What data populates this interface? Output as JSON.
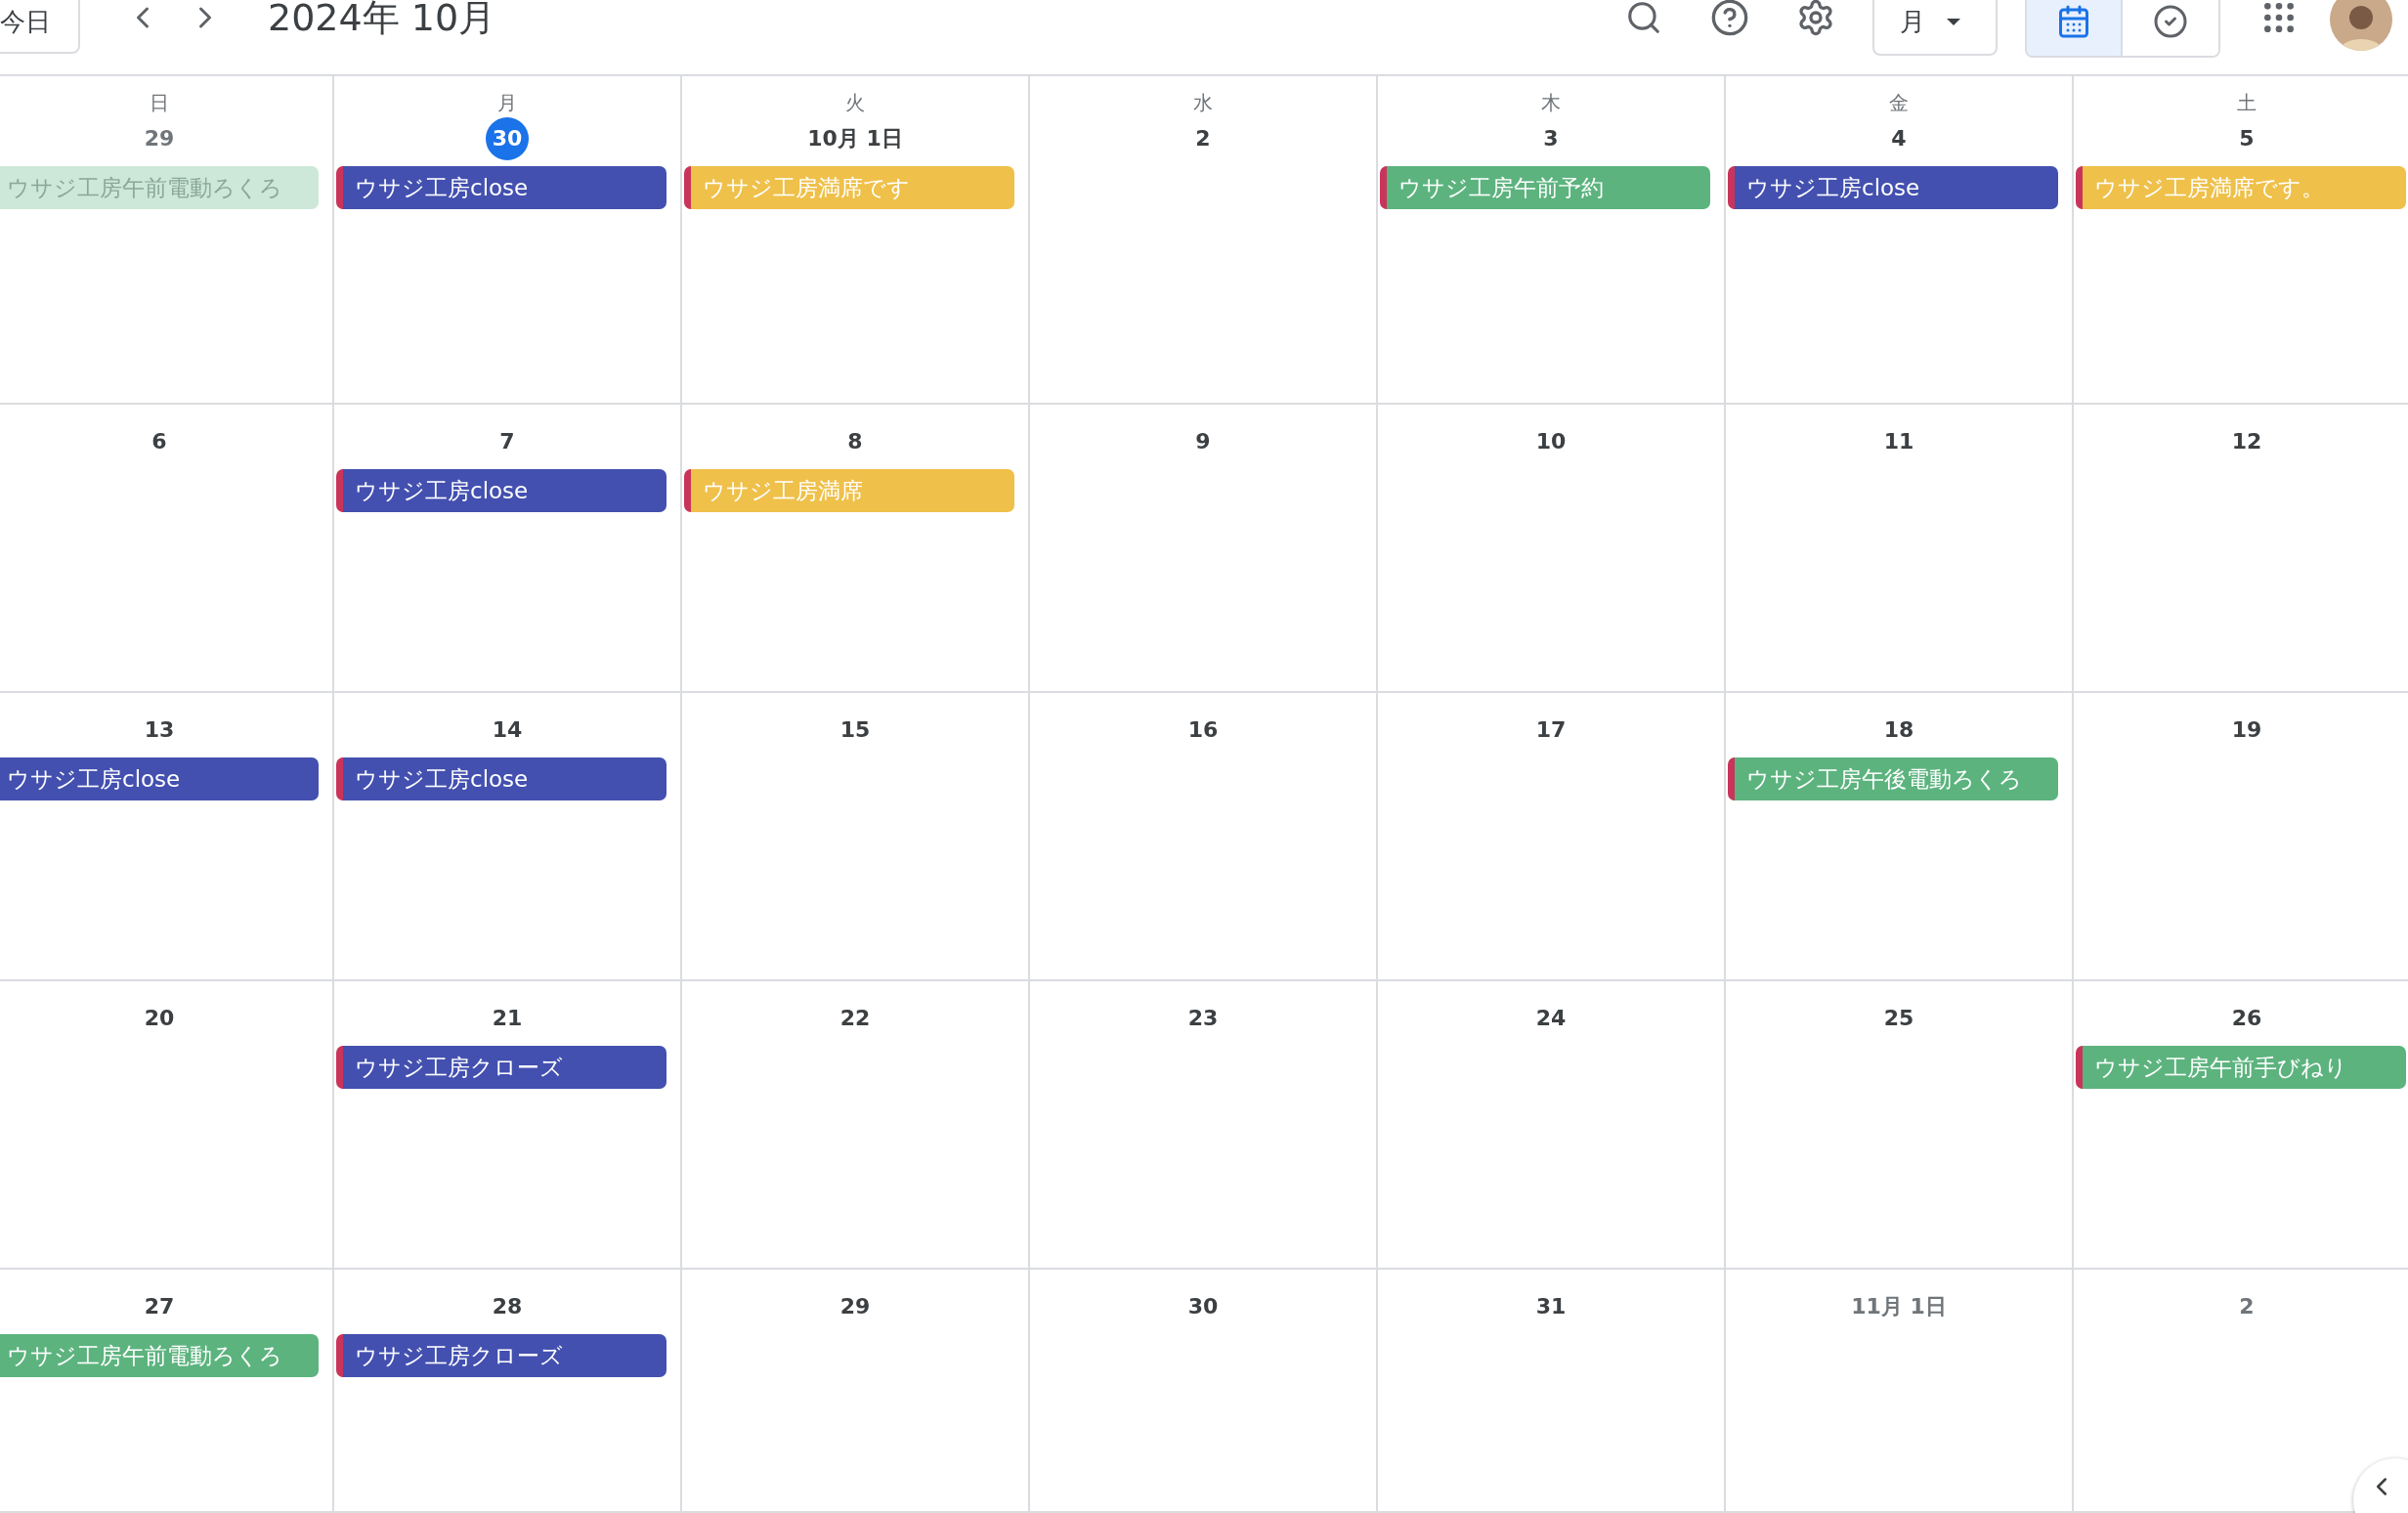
{
  "toolbar": {
    "today_button": "今日",
    "title": "2024年 10月",
    "view_select": "月",
    "view_toggle": [
      {
        "kind": "calendar",
        "selected": true
      },
      {
        "kind": "tasks",
        "selected": false
      }
    ]
  },
  "weekdays": [
    "日",
    "月",
    "火",
    "水",
    "木",
    "金",
    "土"
  ],
  "weeks": [
    [
      {
        "label": "29",
        "in_month": false,
        "today": false,
        "events": [
          {
            "title": "ウサジ工房午前電動ろくろ",
            "color": "#cde8d8",
            "faded": true
          }
        ]
      },
      {
        "label": "30",
        "in_month": false,
        "today": true,
        "events": [
          {
            "title": "ウサジ工房close",
            "color": "#4350af",
            "faded": false
          }
        ]
      },
      {
        "label": "10月 1日",
        "in_month": true,
        "today": false,
        "events": [
          {
            "title": "ウサジ工房満席です",
            "color": "#efc04a",
            "faded": false
          }
        ]
      },
      {
        "label": "2",
        "in_month": true,
        "today": false
      },
      {
        "label": "3",
        "in_month": true,
        "today": false,
        "events": [
          {
            "title": "ウサジ工房午前予約",
            "color": "#5cb37e",
            "faded": false
          }
        ]
      },
      {
        "label": "4",
        "in_month": true,
        "today": false,
        "events": [
          {
            "title": "ウサジ工房close",
            "color": "#4350af",
            "faded": false
          }
        ]
      },
      {
        "label": "5",
        "in_month": true,
        "today": false,
        "events": [
          {
            "title": "ウサジ工房満席です。",
            "color": "#efc04a",
            "faded": false
          }
        ]
      }
    ],
    [
      {
        "label": "6",
        "in_month": true,
        "today": false
      },
      {
        "label": "7",
        "in_month": true,
        "today": false,
        "events": [
          {
            "title": "ウサジ工房close",
            "color": "#4350af",
            "faded": false
          }
        ]
      },
      {
        "label": "8",
        "in_month": true,
        "today": false,
        "events": [
          {
            "title": "ウサジ工房満席",
            "color": "#efc04a",
            "faded": false
          }
        ]
      },
      {
        "label": "9",
        "in_month": true,
        "today": false
      },
      {
        "label": "10",
        "in_month": true,
        "today": false
      },
      {
        "label": "11",
        "in_month": true,
        "today": false
      },
      {
        "label": "12",
        "in_month": true,
        "today": false
      }
    ],
    [
      {
        "label": "13",
        "in_month": true,
        "today": false,
        "events": [
          {
            "title": "ウサジ工房close",
            "color": "#4350af",
            "faded": false
          }
        ]
      },
      {
        "label": "14",
        "in_month": true,
        "today": false,
        "events": [
          {
            "title": "ウサジ工房close",
            "color": "#4350af",
            "faded": false
          }
        ]
      },
      {
        "label": "15",
        "in_month": true,
        "today": false
      },
      {
        "label": "16",
        "in_month": true,
        "today": false
      },
      {
        "label": "17",
        "in_month": true,
        "today": false
      },
      {
        "label": "18",
        "in_month": true,
        "today": false,
        "events": [
          {
            "title": "ウサジ工房午後電動ろくろ",
            "color": "#5cb37e",
            "faded": false
          }
        ]
      },
      {
        "label": "19",
        "in_month": true,
        "today": false
      }
    ],
    [
      {
        "label": "20",
        "in_month": true,
        "today": false
      },
      {
        "label": "21",
        "in_month": true,
        "today": false,
        "events": [
          {
            "title": "ウサジ工房クローズ",
            "color": "#4350af",
            "faded": false
          }
        ]
      },
      {
        "label": "22",
        "in_month": true,
        "today": false
      },
      {
        "label": "23",
        "in_month": true,
        "today": false
      },
      {
        "label": "24",
        "in_month": true,
        "today": false
      },
      {
        "label": "25",
        "in_month": true,
        "today": false
      },
      {
        "label": "26",
        "in_month": true,
        "today": false,
        "events": [
          {
            "title": "ウサジ工房午前手びねり",
            "color": "#5cb37e",
            "faded": false
          }
        ]
      }
    ],
    [
      {
        "label": "27",
        "in_month": true,
        "today": false,
        "events": [
          {
            "title": "ウサジ工房午前電動ろくろ",
            "color": "#5cb37e",
            "faded": false
          }
        ]
      },
      {
        "label": "28",
        "in_month": true,
        "today": false,
        "events": [
          {
            "title": "ウサジ工房クローズ",
            "color": "#4350af",
            "faded": false
          }
        ]
      },
      {
        "label": "29",
        "in_month": true,
        "today": false
      },
      {
        "label": "30",
        "in_month": true,
        "today": false
      },
      {
        "label": "31",
        "in_month": true,
        "today": false
      },
      {
        "label": "11月 1日",
        "in_month": false,
        "today": false
      },
      {
        "label": "2",
        "in_month": false,
        "today": false
      }
    ]
  ]
}
